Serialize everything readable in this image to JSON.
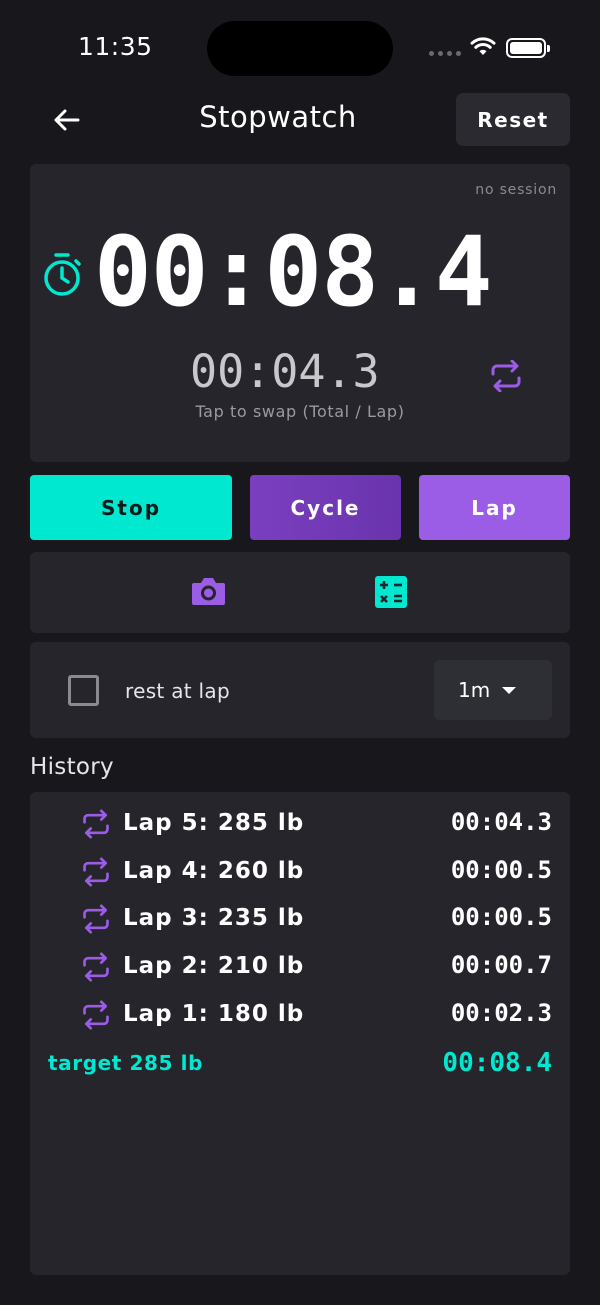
{
  "status_bar": {
    "time": "11:35"
  },
  "header": {
    "title": "Stopwatch",
    "reset_label": "Reset"
  },
  "timer": {
    "session_label": "no session",
    "main_time": "00:08.4",
    "lap_time": "00:04.3",
    "swap_hint": "Tap to swap (Total / Lap)"
  },
  "actions": {
    "stop_label": "Stop",
    "cycle_label": "Cycle",
    "lap_label": "Lap"
  },
  "rest": {
    "label": "rest at lap",
    "checked": false,
    "selected": "1m"
  },
  "history": {
    "title": "History",
    "laps": [
      {
        "label": "Lap 5: 285 lb",
        "time": "00:04.3"
      },
      {
        "label": "Lap 4: 260 lb",
        "time": "00:00.5"
      },
      {
        "label": "Lap 3: 235 lb",
        "time": "00:00.5"
      },
      {
        "label": "Lap 2: 210 lb",
        "time": "00:00.7"
      },
      {
        "label": "Lap 1: 180 lb",
        "time": "00:02.3"
      }
    ],
    "total_label": "target 285 lb",
    "total_time": "00:08.4"
  },
  "icons": {
    "back": "arrow-left-icon",
    "stopwatch": "stopwatch-icon",
    "swap": "repeat-icon",
    "camera": "camera-icon",
    "calculator": "calculator-icon",
    "lap": "repeat-icon"
  },
  "colors": {
    "accent_teal": "#00e8cf",
    "accent_purple": "#9b5de5",
    "cycle_purple": "#7a3fbf",
    "background": "#18181c",
    "card": "#25252b"
  }
}
